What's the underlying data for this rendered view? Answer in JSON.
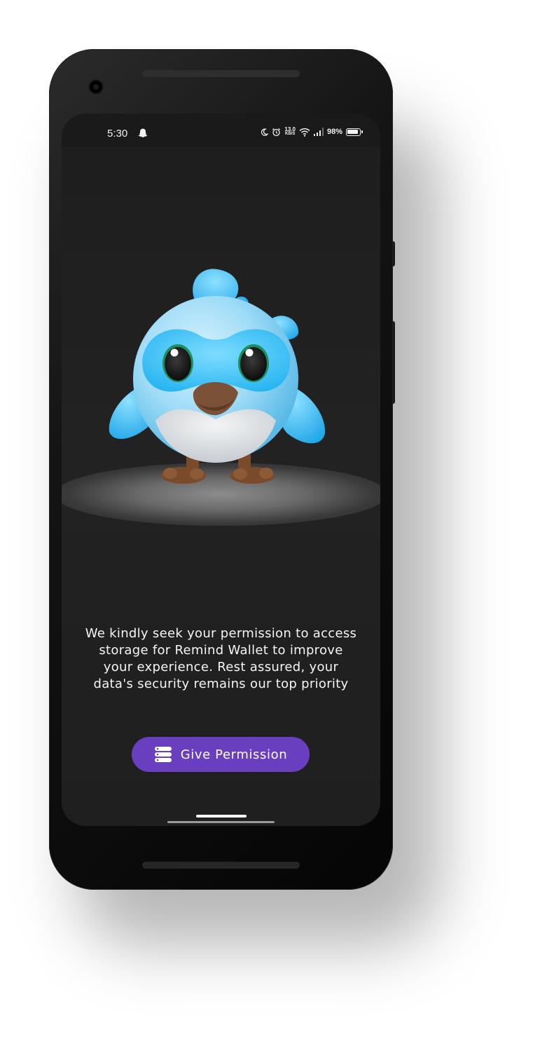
{
  "status_bar": {
    "time": "5:30",
    "net_speed_value": "13.0",
    "net_speed_unit": "KB/S",
    "battery": "98%",
    "icons": [
      "snapchat-ghost-icon",
      "moon-icon",
      "alarm-icon",
      "wifi-icon",
      "signal-icon",
      "battery-icon"
    ]
  },
  "illustration": {
    "subject": "mascot-bird-icon"
  },
  "message": "We kindly seek your permission to access storage for Remind Wallet to improve your experience. Rest assured, your data's security remains our top priority",
  "permission_button": {
    "label": "Give Permission",
    "icon": "storage-icon",
    "color": "#6a3fbf"
  },
  "colors": {
    "background": "#1f1f1f",
    "accent": "#6a3fbf",
    "text": "#f5f5f5"
  }
}
